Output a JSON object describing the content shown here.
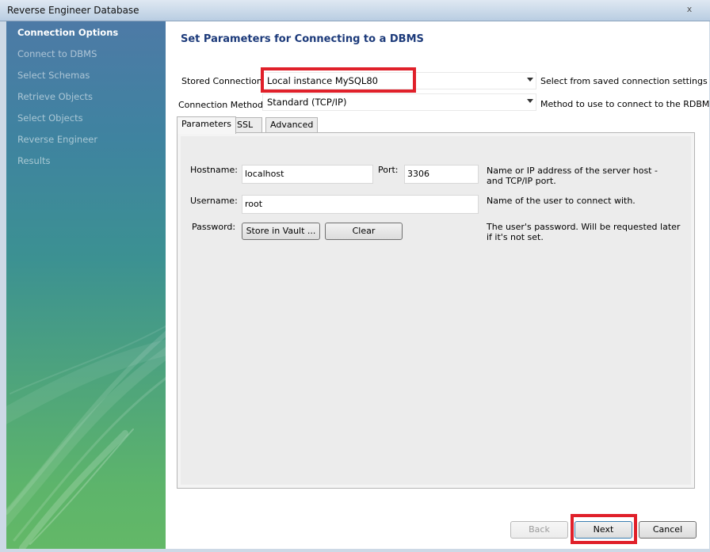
{
  "window": {
    "title": "Reverse Engineer Database",
    "close_glyph": "x"
  },
  "sidebar": {
    "items": [
      {
        "label": "Connection Options",
        "active": true
      },
      {
        "label": "Connect to DBMS",
        "active": false
      },
      {
        "label": "Select Schemas",
        "active": false
      },
      {
        "label": "Retrieve Objects",
        "active": false
      },
      {
        "label": "Select Objects",
        "active": false
      },
      {
        "label": "Reverse Engineer",
        "active": false
      },
      {
        "label": "Results",
        "active": false
      }
    ]
  },
  "main": {
    "heading": "Set Parameters for Connecting to a DBMS",
    "stored_connection": {
      "label": "Stored Connection:",
      "value": "Local instance MySQL80",
      "hint": "Select from saved connection settings"
    },
    "connection_method": {
      "label": "Connection Method:",
      "value": "Standard (TCP/IP)",
      "hint": "Method to use to connect to the RDBMS"
    },
    "tabs": [
      {
        "label": "Parameters",
        "active": true
      },
      {
        "label": "SSL",
        "active": false
      },
      {
        "label": "Advanced",
        "active": false
      }
    ],
    "parameters": {
      "hostname_label": "Hostname:",
      "hostname_value": "localhost",
      "port_label": "Port:",
      "port_value": "3306",
      "host_help": "Name or IP address of the server host - and TCP/IP port.",
      "username_label": "Username:",
      "username_value": "root",
      "username_help": "Name of the user to connect with.",
      "password_label": "Password:",
      "store_vault_label": "Store in Vault ...",
      "clear_label": "Clear",
      "password_help": "The user's password. Will be requested later if it's not set."
    }
  },
  "footer": {
    "back_label": "Back",
    "next_label": "Next",
    "cancel_label": "Cancel"
  },
  "colors": {
    "highlight": "#e0202a",
    "heading": "#1c3a7a"
  }
}
